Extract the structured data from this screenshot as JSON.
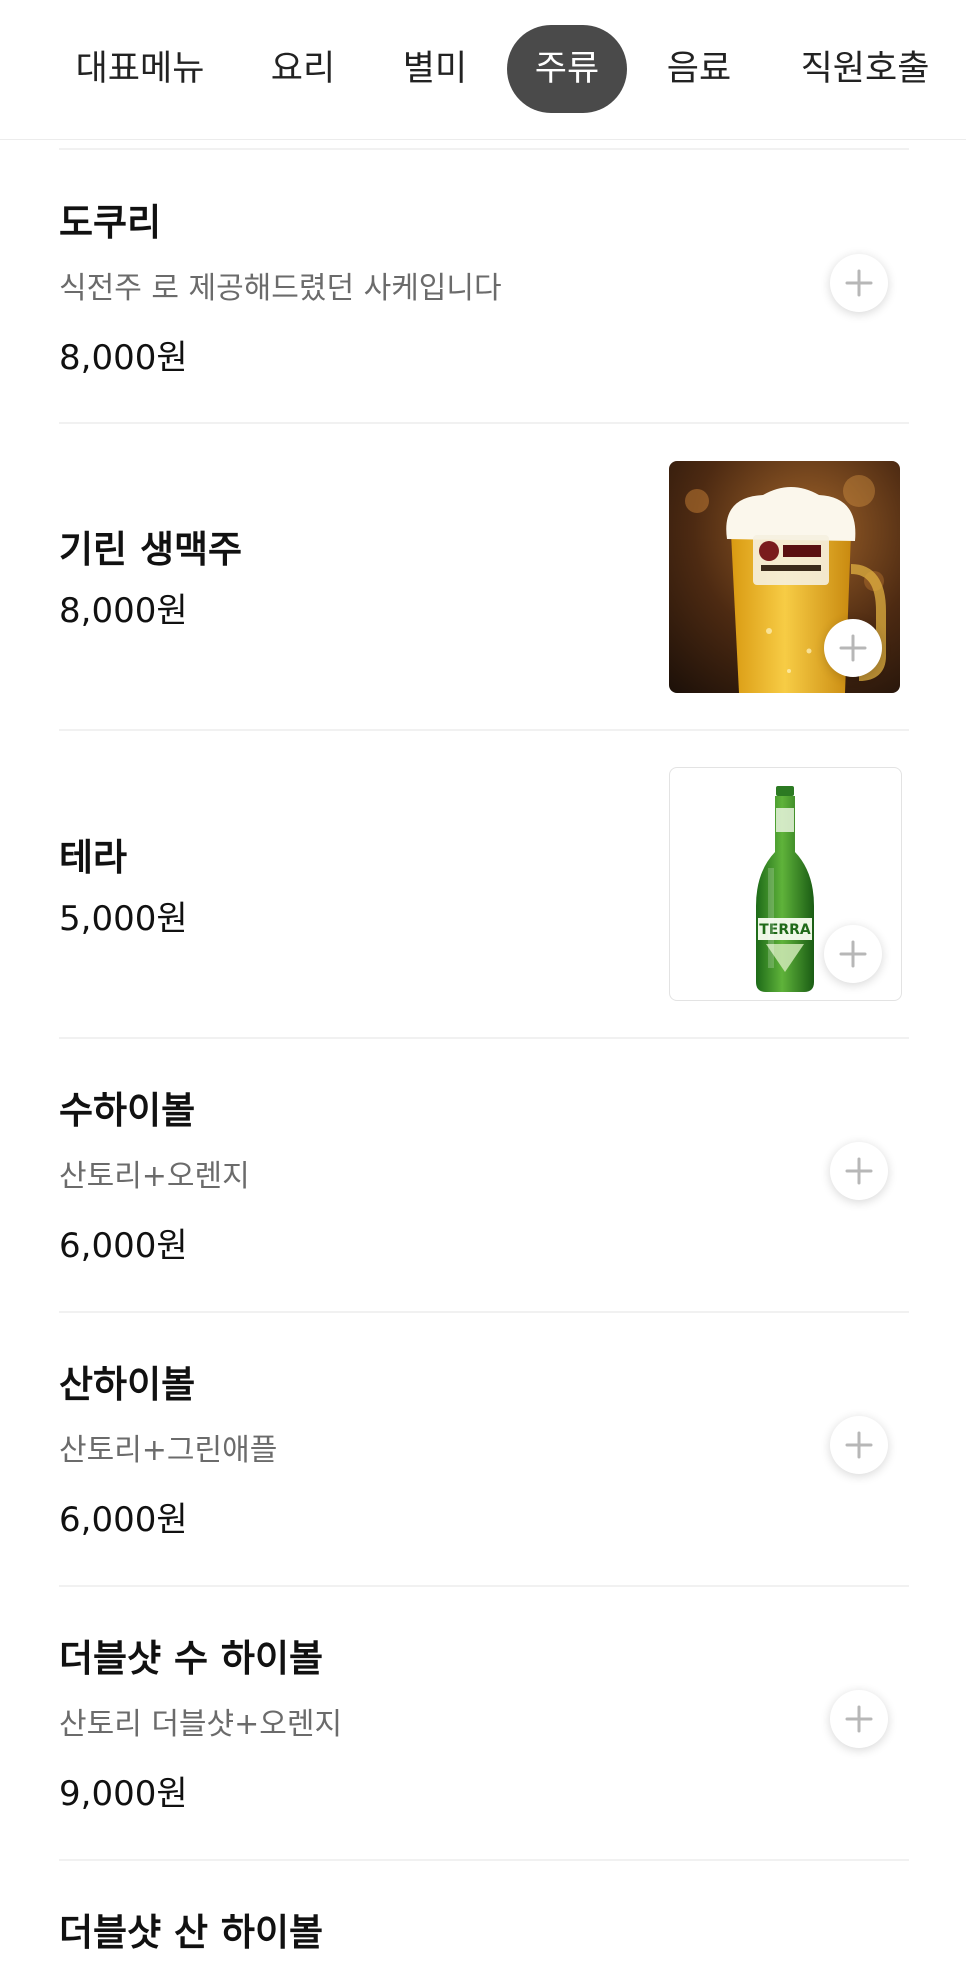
{
  "tabs": [
    {
      "label": "대표메뉴",
      "active": false
    },
    {
      "label": "요리",
      "active": false
    },
    {
      "label": "별미",
      "active": false
    },
    {
      "label": "주류",
      "active": true
    },
    {
      "label": "음료",
      "active": false
    },
    {
      "label": "직원호출",
      "active": false
    }
  ],
  "items": [
    {
      "name": "도쿠리",
      "description": "식전주 로 제공해드렸던 사케입니다",
      "price": "8,000원",
      "image": "none"
    },
    {
      "name": "기린 생맥주",
      "description": "",
      "price": "8,000원",
      "image": "kirin-draft-beer-glass"
    },
    {
      "name": "테라",
      "description": "",
      "price": "5,000원",
      "image": "terra-beer-bottle"
    },
    {
      "name": "수하이볼",
      "description": "산토리+오렌지",
      "price": "6,000원",
      "image": "none"
    },
    {
      "name": "산하이볼",
      "description": "산토리+그린애플",
      "price": "6,000원",
      "image": "none"
    },
    {
      "name": "더블샷 수 하이볼",
      "description": "산토리 더블샷+오렌지",
      "price": "9,000원",
      "image": "none"
    },
    {
      "name": "더블샷 산 하이볼",
      "description": "",
      "price": "",
      "image": "none"
    }
  ],
  "icons": {
    "add": "plus-icon"
  },
  "colors": {
    "active_tab_bg": "#4a4a4a",
    "active_tab_text": "#ffffff",
    "description_text": "#6b6b6b",
    "plus_icon": "#b7b7b7"
  }
}
